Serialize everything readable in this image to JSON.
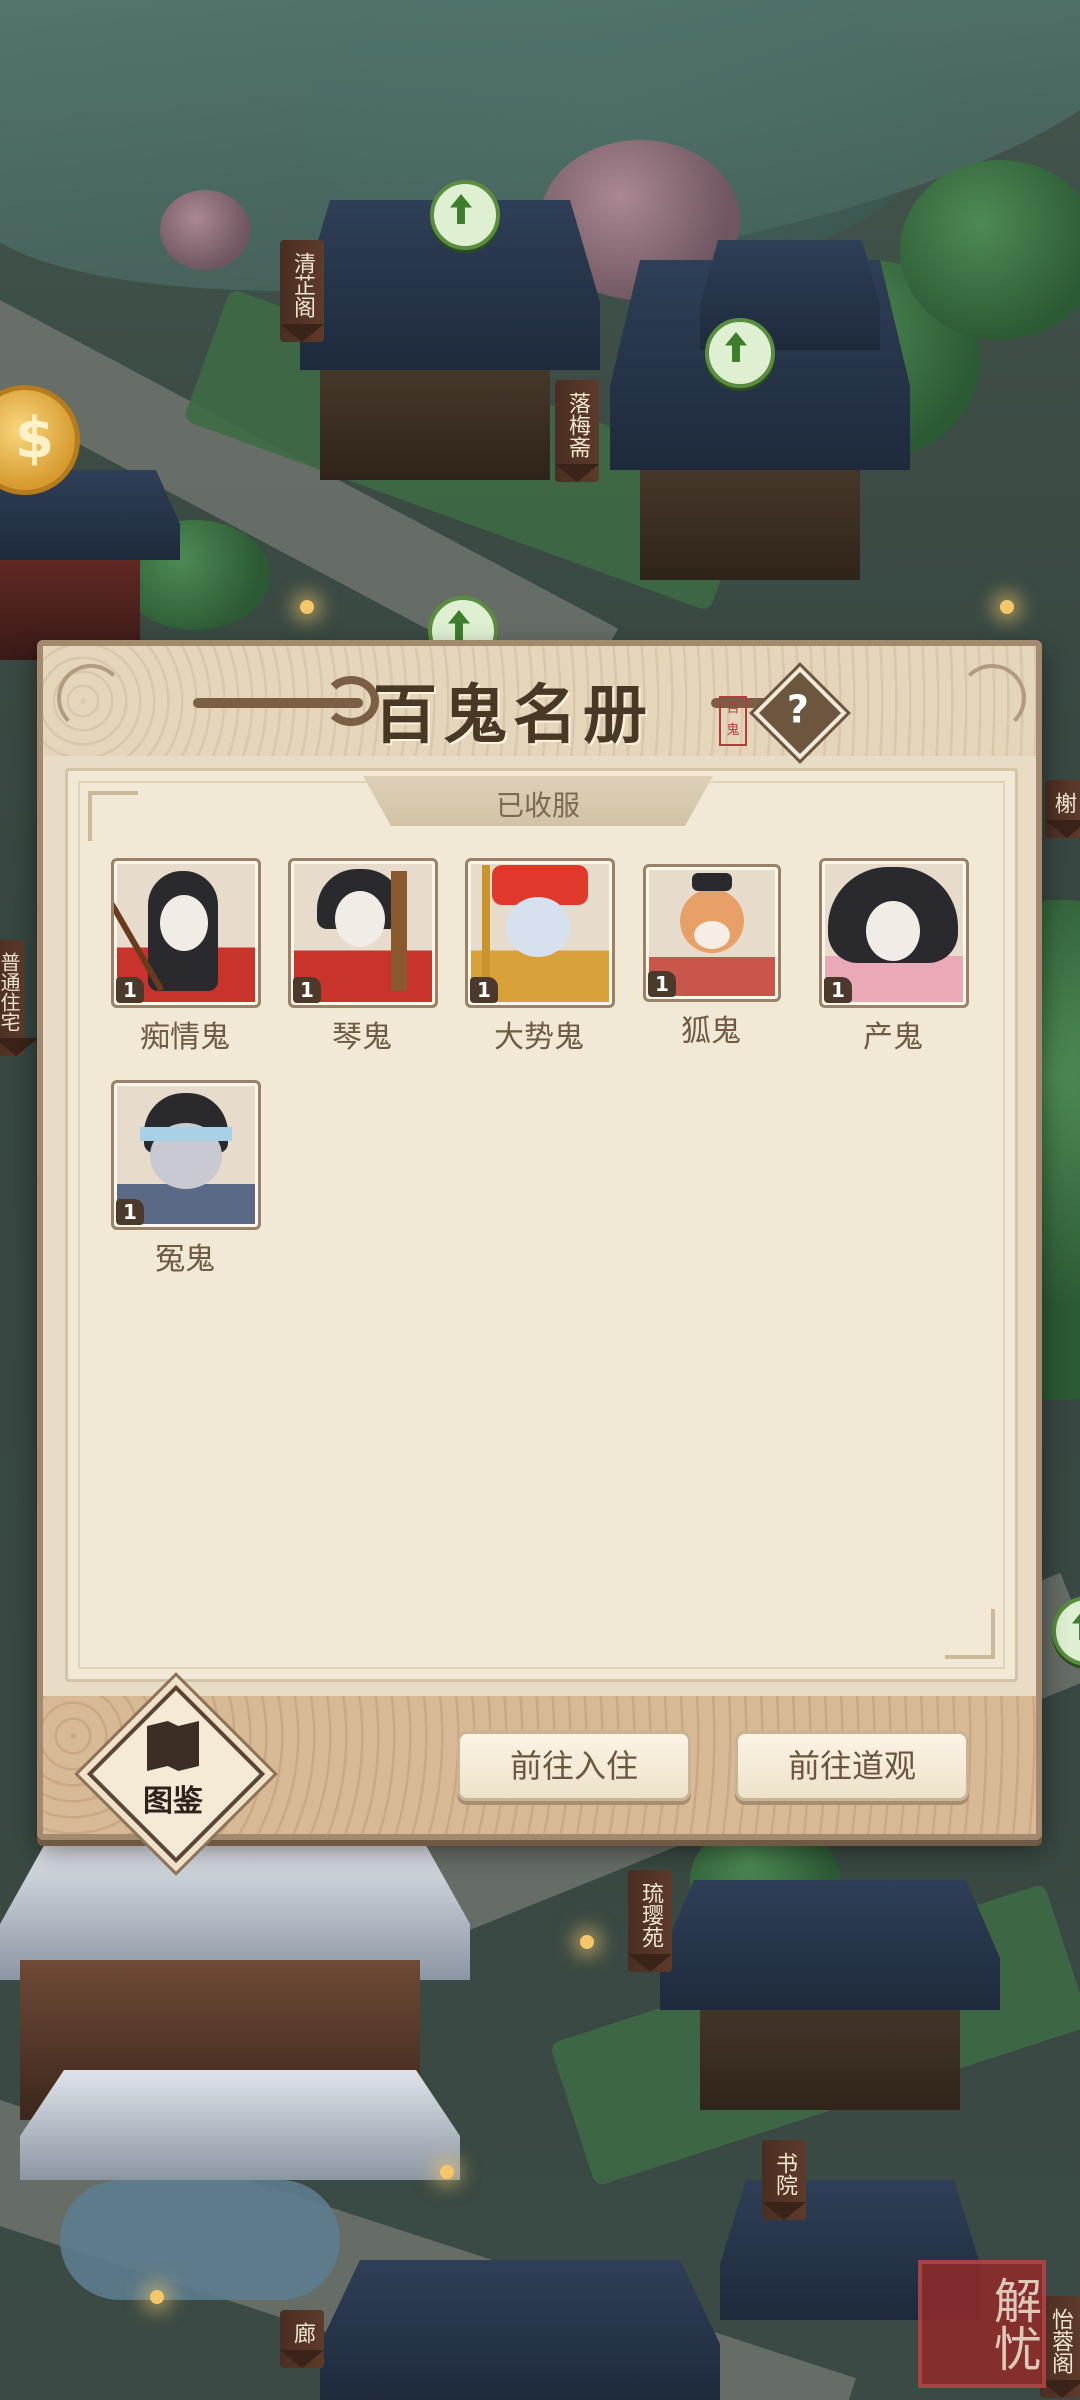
{
  "map": {
    "buildings": [
      "清芷阁",
      "落梅斋",
      "普通住宅",
      "榭",
      "琉璎苑",
      "书院",
      "廊",
      "怡蓉阁"
    ],
    "seal_text": "解忧"
  },
  "dialog": {
    "title": "百鬼名册",
    "title_stamp": "百鬼",
    "help_icon": "?",
    "tab_label": "已收服",
    "ghosts": [
      {
        "name": "痴情鬼",
        "level": "1"
      },
      {
        "name": "琴鬼",
        "level": "1"
      },
      {
        "name": "大势鬼",
        "level": "1"
      },
      {
        "name": "狐鬼",
        "level": "1"
      },
      {
        "name": "产鬼",
        "level": "1"
      },
      {
        "name": "冤鬼",
        "level": "1"
      }
    ],
    "footer": {
      "catalog_label": "图鉴",
      "move_in_button": "前往入住",
      "temple_button": "前往道观"
    }
  },
  "colors": {
    "panel_bg": "#f1e9d6",
    "frame": "#a38a6f",
    "text_brown": "#6f5a44",
    "upgrade_green": "#5a8d3f"
  }
}
